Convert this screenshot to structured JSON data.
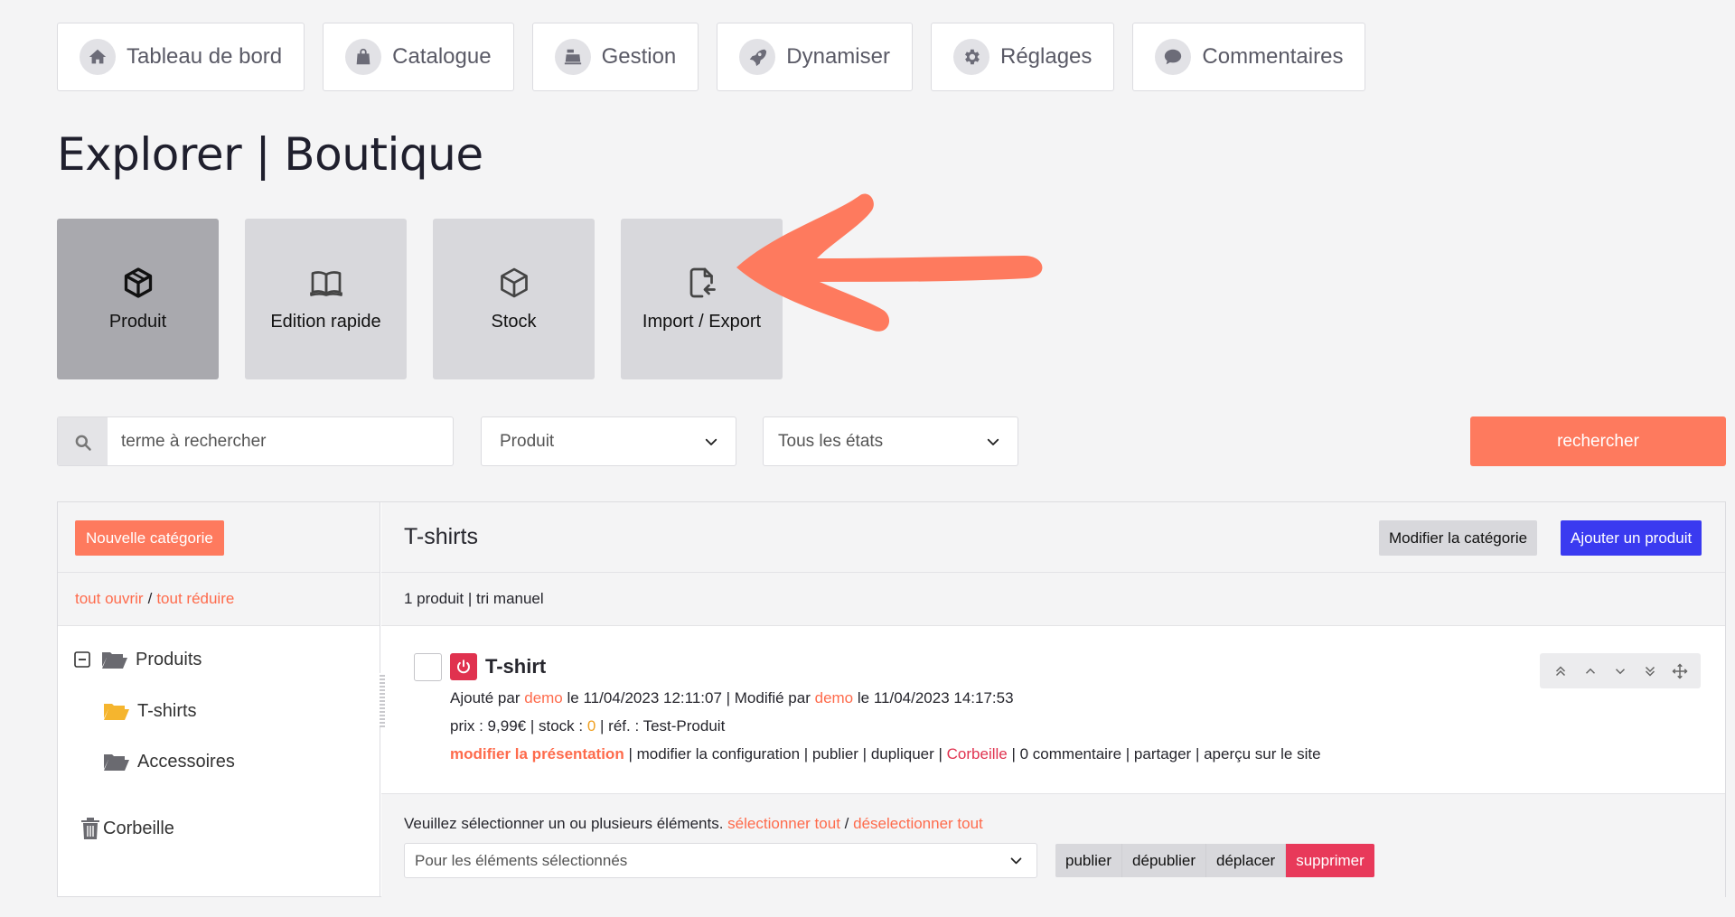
{
  "nav": [
    {
      "label": "Tableau de bord",
      "icon": "home-icon"
    },
    {
      "label": "Catalogue",
      "icon": "bag-icon"
    },
    {
      "label": "Gestion",
      "icon": "cash-register-icon"
    },
    {
      "label": "Dynamiser",
      "icon": "rocket-icon"
    },
    {
      "label": "Réglages",
      "icon": "gear-icon"
    },
    {
      "label": "Commentaires",
      "icon": "comment-icon"
    }
  ],
  "page_title": "Explorer | Boutique",
  "tiles": [
    {
      "label": "Produit",
      "icon": "cube-icon",
      "active": true
    },
    {
      "label": "Edition rapide",
      "icon": "open-book-icon",
      "active": false
    },
    {
      "label": "Stock",
      "icon": "cube-outline-icon",
      "active": false
    },
    {
      "label": "Import / Export",
      "icon": "file-import-icon",
      "active": false
    }
  ],
  "search": {
    "placeholder": "terme à rechercher",
    "type_select": "Produit",
    "state_select": "Tous les états",
    "button": "rechercher"
  },
  "left": {
    "new_category": "Nouvelle catégorie",
    "open_all": "tout ouvrir",
    "separator": "/",
    "collapse_all": "tout réduire",
    "tree": {
      "root": "Produits",
      "children": [
        "T-shirts",
        "Accessoires"
      ],
      "trash": "Corbeille"
    }
  },
  "right": {
    "category_title": "T-shirts",
    "edit_category": "Modifier la catégorie",
    "add_product": "Ajouter un produit",
    "summary": "1 produit | tri manuel"
  },
  "product": {
    "name": "T-shirt",
    "added_prefix": "Ajouté par",
    "added_by": "demo",
    "added_on": "le 11/04/2023 12:11:07 | Modifié par",
    "modified_by": "demo",
    "modified_on": "le 11/04/2023 14:17:53",
    "price_text": "prix : 9,99€ | stock :",
    "stock": "0",
    "ref_text": "| réf. : Test-Produit",
    "actions": {
      "edit_presentation": "modifier la présentation",
      "rest1": "| modifier la configuration | publier | dupliquer |",
      "trash": "Corbeille",
      "rest2": "| 0 commentaire | partager | aperçu sur le site"
    }
  },
  "bulk": {
    "instruction": "Veuillez sélectionner un ou plusieurs éléments.",
    "select_all": "sélectionner tout",
    "separator": "/",
    "deselect_all": "déselectionner tout",
    "select_placeholder": "Pour les éléments sélectionnés",
    "publish": "publier",
    "unpublish": "dépublier",
    "move": "déplacer",
    "delete": "supprimer"
  },
  "colors": {
    "accent": "#fe7a5e",
    "primary": "#3a3af0",
    "danger": "#e0324f",
    "folder": "#f5b52e"
  }
}
